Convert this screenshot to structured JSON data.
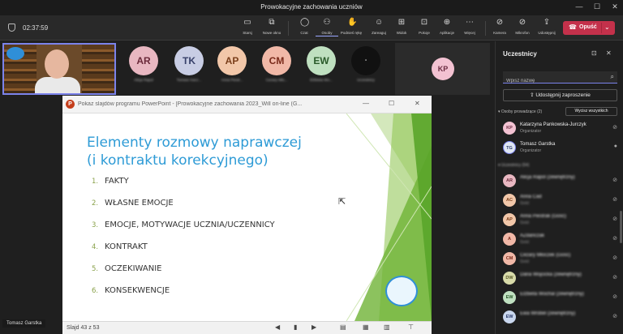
{
  "window": {
    "title": "Prowokacyjne zachowania uczniów"
  },
  "meeting": {
    "timer": "02:37:59"
  },
  "toolbar": {
    "items": [
      {
        "label": "Starsj",
        "icon": "stage-icon"
      },
      {
        "label": "Nowe okno",
        "icon": "new-window-icon"
      },
      {
        "label": "Czat",
        "icon": "chat-icon"
      },
      {
        "label": "Osoby",
        "icon": "people-icon"
      },
      {
        "label": "Podnieś rękę",
        "icon": "raise-hand-icon"
      },
      {
        "label": "Zareaguj",
        "icon": "react-icon"
      },
      {
        "label": "Widok",
        "icon": "view-icon"
      },
      {
        "label": "Pokoje",
        "icon": "rooms-icon"
      },
      {
        "label": "Aplikacje",
        "icon": "apps-icon"
      },
      {
        "label": "Więcej",
        "icon": "more-icon"
      },
      {
        "label": "Kamera",
        "icon": "camera-off-icon"
      },
      {
        "label": "Mikrofon",
        "icon": "mic-off-icon"
      },
      {
        "label": "Udostępnij",
        "icon": "share-icon"
      }
    ],
    "leave_label": "Opuść"
  },
  "tiles": [
    {
      "initials": "AR",
      "name": "Alicja Rapol",
      "color": "#e8b7c1"
    },
    {
      "initials": "TK",
      "name": "Tomasz Kacz...",
      "color": "#c8cde4"
    },
    {
      "initials": "AP",
      "name": "Anna Piestr...",
      "color": "#f2c7a9"
    },
    {
      "initials": "CM",
      "name": "Cezary Mło...",
      "color": "#f1b8a7"
    },
    {
      "initials": "EW",
      "name": "Elżbieta Wo...",
      "color": "#bfe0c0"
    },
    {
      "initials": "",
      "name": "Uczestnicy",
      "color": "#111111"
    }
  ],
  "kp_tile": {
    "initials": "KP",
    "color": "#f3c2d2"
  },
  "self": {
    "name": "Tomasz Garstka"
  },
  "ppt": {
    "window_title": "Pokaz slajdów programu PowerPoint - [Prowokacyjne zachowania 2023_Will on-line (G...",
    "slide_title_line1": "Elementy rozmowy naprawczej",
    "slide_title_line2": "(i kontraktu korekcyjnego)",
    "items": [
      {
        "num": "1.",
        "text": "FAKTY"
      },
      {
        "num": "2.",
        "text": "WŁASNE EMOCJE"
      },
      {
        "num": "3.",
        "text": "EMOCJE, MOTYWACJE UCZNIA/UCZENNICY"
      },
      {
        "num": "4.",
        "text": "KONTRAKT"
      },
      {
        "num": "5.",
        "text": "OCZEKIWANIE"
      },
      {
        "num": "6.",
        "text": "KONSEKWENCJE"
      }
    ],
    "slide_counter": "Slajd 43 z 53"
  },
  "panel": {
    "title": "Uczestnicy",
    "search_placeholder": "Wpisz nazwę",
    "share_invite": "Udostępnij zaproszenie",
    "organizers_section": "Osoby prowadzące (2)",
    "mute_all": "Wycisz wszystkich",
    "attendees_section": "Uczestnicy (54)",
    "organizers": [
      {
        "initials": "KP",
        "name": "Katarzyna Pankowska-Jurczyk",
        "role": "Organizator",
        "color": "#f3c2d2"
      },
      {
        "initials": "TG",
        "name": "Tomasz Garstka",
        "role": "Organizator",
        "color": "#dfe6f3"
      }
    ],
    "attendees": [
      {
        "initials": "AR",
        "name": "Alicja Rapol (zewnętrzny)",
        "role": "",
        "color": "#e8b7c1"
      },
      {
        "initials": "AC",
        "name": "Anna Cad",
        "role": "Gość",
        "color": "#f2c7a9"
      },
      {
        "initials": "AP",
        "name": "Anna Piestrak (Gość)",
        "role": "Gość",
        "color": "#f2c7a9"
      },
      {
        "initials": "A",
        "name": "AZdanczak",
        "role": "Gość",
        "color": "#f1b8a7"
      },
      {
        "initials": "CM",
        "name": "Cezary Młoczek (Gość)",
        "role": "Gość",
        "color": "#f1b8a7"
      },
      {
        "initials": "DW",
        "name": "Daria Wojcicka (zewnętrzny)",
        "role": "",
        "color": "#d8dba9"
      },
      {
        "initials": "EW",
        "name": "Elżbieta Wochal (zewnętrzny)",
        "role": "",
        "color": "#bfe0c0"
      },
      {
        "initials": "EW",
        "name": "Ewa Wróbel (zewnętrzny)",
        "role": "",
        "color": "#c9d7ee"
      }
    ]
  },
  "colors": {
    "accent": "#7b83eb",
    "leave": "#c4314b",
    "slide_title": "#2e9bd6",
    "slide_green": "#7cc04b"
  }
}
